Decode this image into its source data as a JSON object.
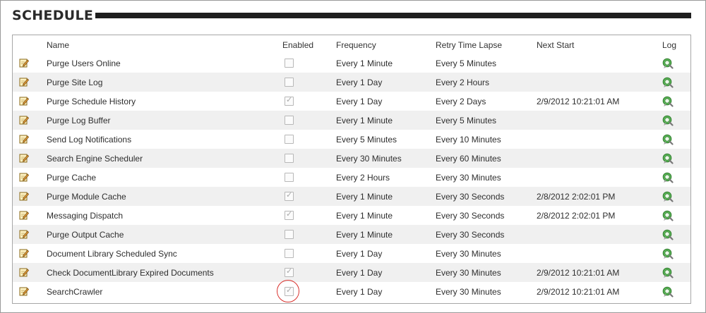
{
  "page_title": "SCHEDULE",
  "columns": {
    "name": "Name",
    "enabled": "Enabled",
    "frequency": "Frequency",
    "retry": "Retry Time Lapse",
    "next_start": "Next Start",
    "log": "Log"
  },
  "icons": {
    "edit": "edit-pencil-icon",
    "log": "log-view-icon"
  },
  "colors": {
    "header_bar": "#1e1e1e",
    "alt_row": "#f0f0f0",
    "highlight_circle": "#d9322e"
  },
  "rows": [
    {
      "name": "Purge Users Online",
      "enabled": false,
      "frequency": "Every 1 Minute",
      "retry": "Every 5 Minutes",
      "next_start": ""
    },
    {
      "name": "Purge Site Log",
      "enabled": false,
      "frequency": "Every 1 Day",
      "retry": "Every 2 Hours",
      "next_start": ""
    },
    {
      "name": "Purge Schedule History",
      "enabled": true,
      "frequency": "Every 1 Day",
      "retry": "Every 2 Days",
      "next_start": "2/9/2012 10:21:01 AM"
    },
    {
      "name": "Purge Log Buffer",
      "enabled": false,
      "frequency": "Every 1 Minute",
      "retry": "Every 5 Minutes",
      "next_start": ""
    },
    {
      "name": "Send Log Notifications",
      "enabled": false,
      "frequency": "Every 5 Minutes",
      "retry": "Every 10 Minutes",
      "next_start": ""
    },
    {
      "name": "Search Engine Scheduler",
      "enabled": false,
      "frequency": "Every 30 Minutes",
      "retry": "Every 60 Minutes",
      "next_start": ""
    },
    {
      "name": "Purge Cache",
      "enabled": false,
      "frequency": "Every 2 Hours",
      "retry": "Every 30 Minutes",
      "next_start": ""
    },
    {
      "name": "Purge Module Cache",
      "enabled": true,
      "frequency": "Every 1 Minute",
      "retry": "Every 30 Seconds",
      "next_start": "2/8/2012 2:02:01 PM"
    },
    {
      "name": "Messaging Dispatch",
      "enabled": true,
      "frequency": "Every 1 Minute",
      "retry": "Every 30 Seconds",
      "next_start": "2/8/2012 2:02:01 PM"
    },
    {
      "name": "Purge Output Cache",
      "enabled": false,
      "frequency": "Every 1 Minute",
      "retry": "Every 30 Seconds",
      "next_start": ""
    },
    {
      "name": "Document Library Scheduled Sync",
      "enabled": false,
      "frequency": "Every 1 Day",
      "retry": "Every 30 Minutes",
      "next_start": ""
    },
    {
      "name": "Check DocumentLibrary Expired Documents",
      "enabled": true,
      "frequency": "Every 1 Day",
      "retry": "Every 30 Minutes",
      "next_start": "2/9/2012 10:21:01 AM"
    },
    {
      "name": "SearchCrawler",
      "enabled": true,
      "frequency": "Every 1 Day",
      "retry": "Every 30 Minutes",
      "next_start": "2/9/2012 10:21:01 AM",
      "highlighted": true
    }
  ]
}
